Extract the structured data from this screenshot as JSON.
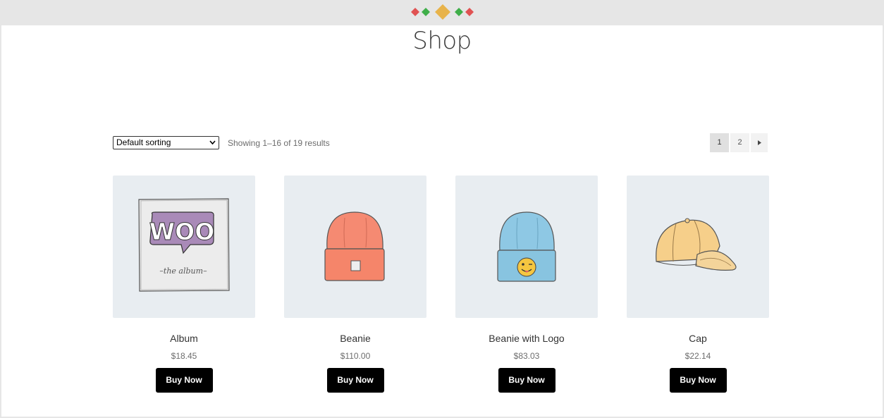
{
  "page": {
    "title": "Shop"
  },
  "toolbar": {
    "sort_selected": "Default sorting",
    "result_count": "Showing 1–16 of 19 results"
  },
  "pagination": {
    "pages": [
      "1",
      "2"
    ],
    "current": "1",
    "next_icon": "triangle-right-icon"
  },
  "products": [
    {
      "name": "Album",
      "price": "$18.45",
      "button": "Buy Now",
      "image": "woo-album-image"
    },
    {
      "name": "Beanie",
      "price": "$110.00",
      "button": "Buy Now",
      "image": "orange-beanie-image"
    },
    {
      "name": "Beanie with Logo",
      "price": "$83.03",
      "button": "Buy Now",
      "image": "blue-beanie-logo-image"
    },
    {
      "name": "Cap",
      "price": "$22.14",
      "button": "Buy Now",
      "image": "yellow-cap-image"
    }
  ],
  "album_art": {
    "logo_text": "WOO",
    "caption": "–the album–"
  },
  "colors": {
    "tile_bg": "#e8edf1",
    "button_bg": "#000000",
    "logo_red": "#e05252",
    "logo_green": "#3fae49",
    "logo_gold": "#e8b34a"
  }
}
